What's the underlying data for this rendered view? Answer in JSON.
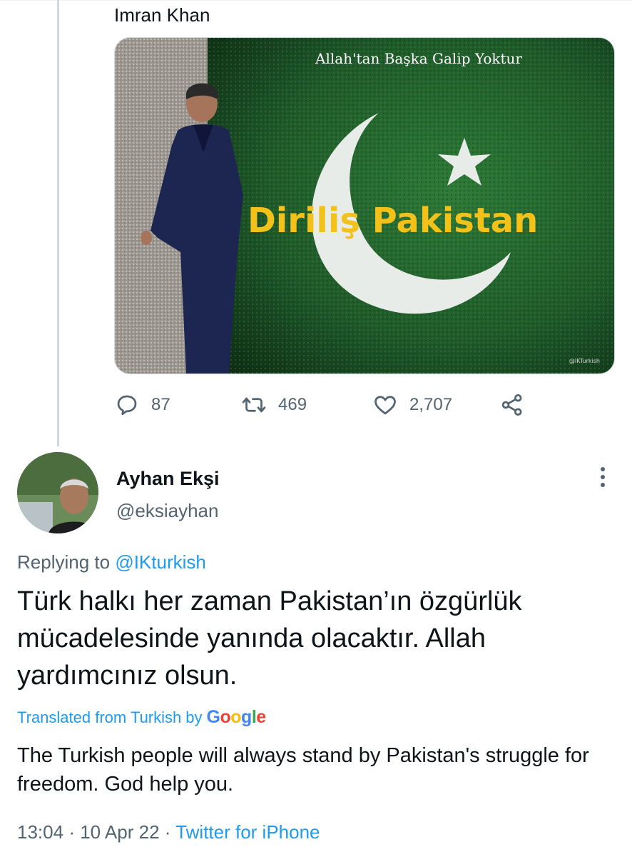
{
  "quoted": {
    "text": "Imran Khan",
    "media": {
      "top_caption": "Allah'tan Başka Galip Yoktur",
      "headline": "Diriliş Pakistan",
      "watermark": "@IKTurkish"
    },
    "actions": {
      "replies": "87",
      "retweets": "469",
      "likes": "2,707"
    }
  },
  "reply": {
    "author_name": "Ayhan Ekşi",
    "author_handle": "@eksiayhan",
    "replying_prefix": "Replying to",
    "replying_to": "@IKturkish",
    "text": "Türk halkı her zaman Pakistan’ın özgürlük mücadelesinde yanında olacaktır. Allah yardımcınız olsun.",
    "translated_label": "Translated from Turkish",
    "translated_by": "by",
    "google": [
      "G",
      "o",
      "o",
      "g",
      "l",
      "e"
    ],
    "translation": "The Turkish people will always stand by Pakistan's struggle for freedom. God help you.",
    "time": "13:04",
    "date": "10 Apr 22",
    "source": "Twitter for iPhone",
    "separator": "·"
  },
  "colors": {
    "accent": "#1d9bf0",
    "secondary_text": "#536471",
    "flag_green": "#1f5a2a",
    "headline_yellow": "#f2c21b"
  },
  "icons": [
    "reply-icon",
    "retweet-icon",
    "like-icon",
    "share-icon",
    "more-icon"
  ]
}
